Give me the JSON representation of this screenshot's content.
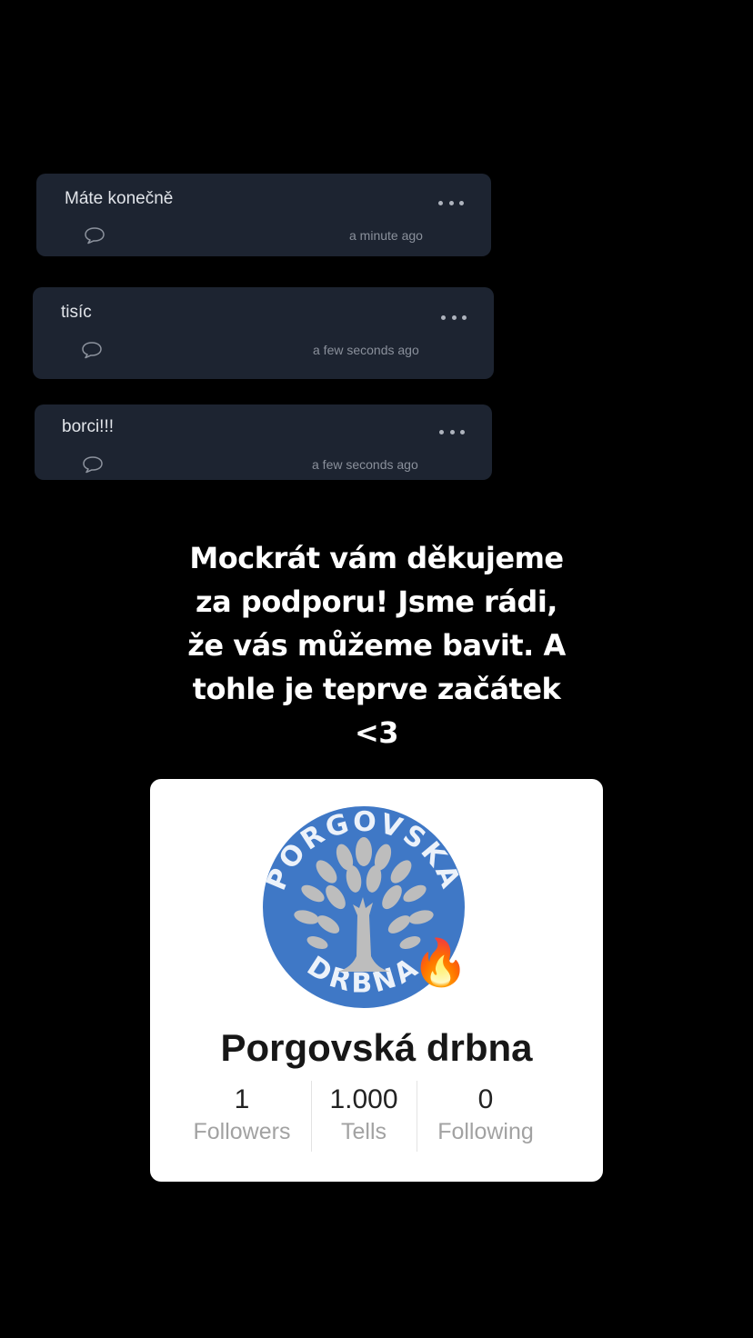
{
  "comments": [
    {
      "text": "Máte konečně",
      "time": "a minute ago"
    },
    {
      "text": "tisíc",
      "time": "a few seconds ago"
    },
    {
      "text": "borci!!!",
      "time": "a few seconds ago"
    }
  ],
  "message": {
    "lines": [
      "Mockrát vám děkujeme",
      "za podporu! Jsme rádi,",
      "že vás můžeme bavit. A",
      "tohle je teprve začátek",
      "<3"
    ]
  },
  "profile": {
    "name": "Porgovská drbna",
    "avatar_text_top": "PORGOVSKÁ",
    "avatar_text_bottom": "DRBNA",
    "badge": "🔥",
    "stats": [
      {
        "value": "1",
        "label": "Followers"
      },
      {
        "value": "1.000",
        "label": "Tells"
      },
      {
        "value": "0",
        "label": "Following"
      }
    ]
  },
  "colors": {
    "background": "#000000",
    "card": "#1d2431",
    "avatar": "#3f78c6"
  }
}
